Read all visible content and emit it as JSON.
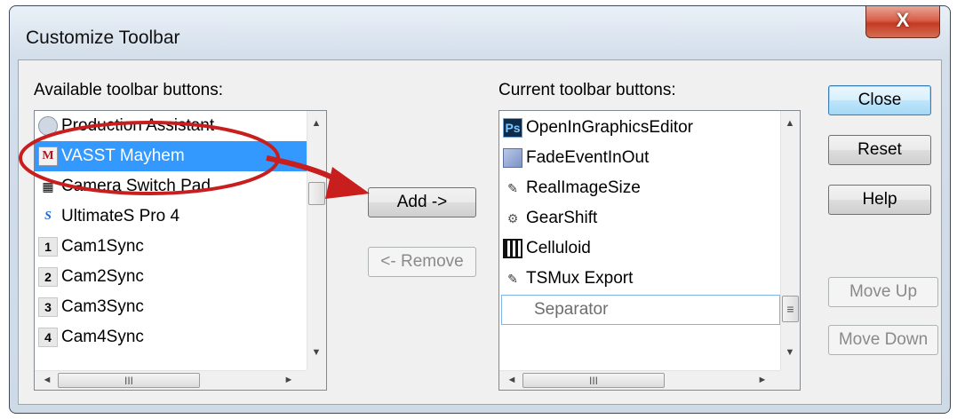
{
  "window": {
    "title": "Customize Toolbar",
    "close_glyph": "X"
  },
  "available": {
    "label": "Available toolbar buttons:",
    "items": [
      {
        "label": "Production Assistant",
        "icon": "production-assistant-icon"
      },
      {
        "label": "VASST Mayhem",
        "icon": "mayhem-icon",
        "selected": true
      },
      {
        "label": "Camera Switch Pad",
        "icon": "camera-switch-icon"
      },
      {
        "label": "UltimateS Pro 4",
        "icon": "ultimates-icon"
      },
      {
        "label": "Cam1Sync",
        "icon": "number-1-icon",
        "glyph": "1"
      },
      {
        "label": "Cam2Sync",
        "icon": "number-2-icon",
        "glyph": "2"
      },
      {
        "label": "Cam3Sync",
        "icon": "number-3-icon",
        "glyph": "3"
      },
      {
        "label": "Cam4Sync",
        "icon": "number-4-icon",
        "glyph": "4"
      }
    ]
  },
  "current": {
    "label": "Current toolbar buttons:",
    "items": [
      {
        "label": "OpenInGraphicsEditor",
        "icon": "photoshop-icon",
        "glyph": "Ps"
      },
      {
        "label": "FadeEventInOut",
        "icon": "fade-icon"
      },
      {
        "label": "RealImageSize",
        "icon": "script-icon"
      },
      {
        "label": "GearShift",
        "icon": "gearshift-icon"
      },
      {
        "label": "Celluloid",
        "icon": "film-icon"
      },
      {
        "label": "TSMux Export",
        "icon": "script-icon"
      },
      {
        "label": "Separator",
        "icon": "none",
        "separator": true
      }
    ]
  },
  "buttons": {
    "add": "Add ->",
    "remove": "<- Remove",
    "close": "Close",
    "reset": "Reset",
    "help": "Help",
    "move_up": "Move Up",
    "move_down": "Move Down"
  },
  "scroll_glyphs": {
    "up": "▲",
    "down": "▼",
    "left": "◄",
    "right": "►",
    "grip": "III",
    "grip_v": "≡"
  },
  "colors": {
    "selection": "#3399ff",
    "annotation": "#d42020"
  }
}
